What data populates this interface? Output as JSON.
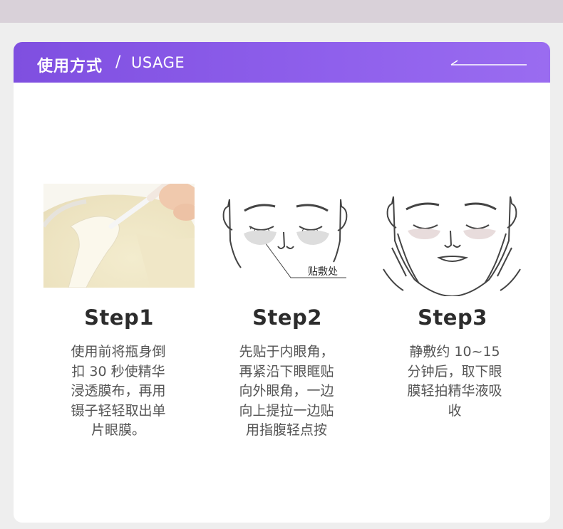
{
  "header": {
    "title": "使用方式",
    "separator": "/",
    "subtitle": "USAGE"
  },
  "steps": [
    {
      "title": "Step1",
      "lines": [
        "使用前将瓶身倒",
        "扣 30 秒使精华",
        "浸透膜布，再用",
        "镊子轻轻取出单",
        "片眼膜。"
      ]
    },
    {
      "title": "Step2",
      "image_label": "贴敷处",
      "lines": [
        "先贴于内眼角，",
        "再紧沿下眼眶贴",
        "向外眼角，一边",
        "向上提拉一边贴",
        "用指腹轻点按"
      ]
    },
    {
      "title": "Step3",
      "lines": [
        "静敷约 10~15",
        "分钟后，取下眼",
        "膜轻拍精华液吸",
        "收"
      ]
    }
  ],
  "colors": {
    "header_start": "#7f4fe0",
    "header_end": "#9a6cf0",
    "title": "#2c2c2c",
    "text": "#555555",
    "patch": "#dddddd"
  }
}
